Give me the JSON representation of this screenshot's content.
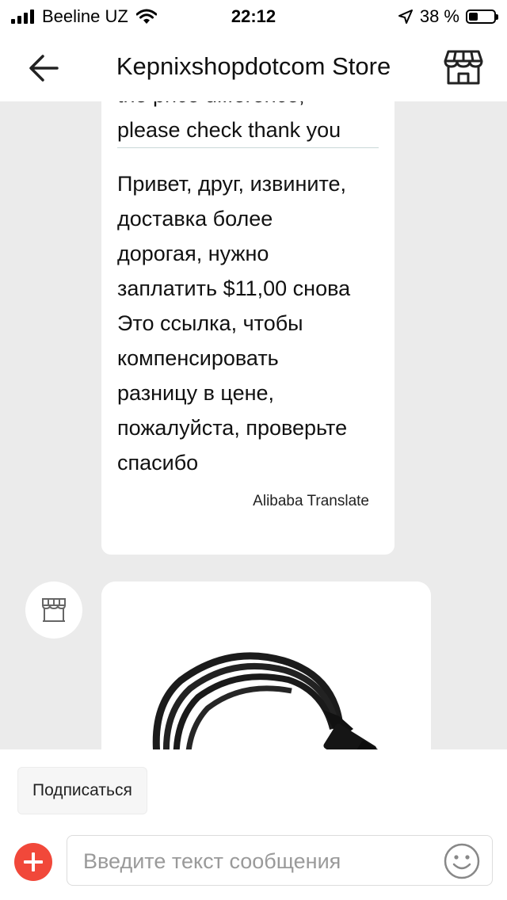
{
  "status_bar": {
    "carrier": "Beeline UZ",
    "time": "22:12",
    "battery_percent": "38 %",
    "battery_level": 0.38,
    "icons": [
      "signal-icon",
      "wifi-icon",
      "location-arrow-icon",
      "battery-icon"
    ]
  },
  "header": {
    "title": "Kepnixshopdotcom Store",
    "back_icon": "arrow-left-icon",
    "store_icon": "storefront-icon"
  },
  "messages": {
    "original_lines": [
      "the price difference,",
      "please check thank you"
    ],
    "translated_lines": [
      "Привет, друг, извините,",
      "доставка более",
      "дорогая, нужно",
      "заплатить $11,00 снова",
      "Это ссылка, чтобы",
      "компенсировать",
      "разницу в цене,",
      "пожалуйста, проверьте",
      "спасибо"
    ],
    "translation_provider": "Alibaba Translate",
    "product_image": "hdmi-cable-image"
  },
  "bottom": {
    "subscribe_label": "Подписаться",
    "input_placeholder": "Введите текст сообщения",
    "input_value": "",
    "plus_icon": "plus-icon",
    "emoji_icon": "smiley-icon"
  },
  "colors": {
    "accent": "#f1483a",
    "chat_background": "#ebebeb",
    "bubble": "#ffffff"
  }
}
